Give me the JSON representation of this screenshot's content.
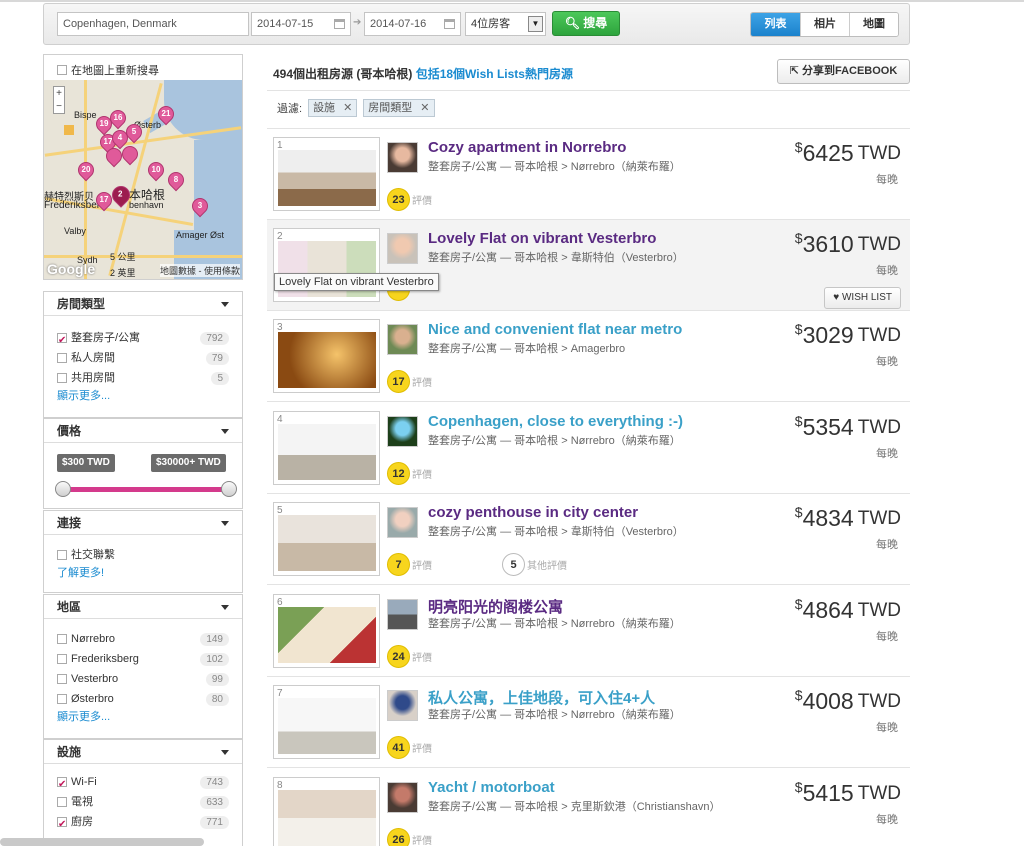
{
  "search": {
    "location": "Copenhagen, Denmark",
    "checkin": "2014-07-15",
    "checkout": "2014-07-16",
    "guests": "4位房客",
    "search_label": "搜尋"
  },
  "views": [
    "列表",
    "相片",
    "地圖"
  ],
  "map": {
    "redo_label": "在地圖上重新搜尋",
    "labels": [
      "Bispe",
      "Østerb",
      "赫特烈斯贝",
      "Frederiksber",
      "本哈根",
      "benhavn",
      "Valby",
      "Amager Øst",
      "Sydh",
      "5 公里",
      "2 英里",
      "地圖數據 - 使用條款",
      "Google"
    ],
    "pins": [
      "19",
      "16",
      "17",
      "4",
      "21",
      "20",
      "10",
      "2",
      "8",
      "17",
      "3",
      "5"
    ]
  },
  "filters_panel": {
    "room_type": {
      "title": "房間類型",
      "options": [
        {
          "label": "整套房子/公寓",
          "count": "792",
          "checked": true
        },
        {
          "label": "私人房間",
          "count": "79",
          "checked": false
        },
        {
          "label": "共用房間",
          "count": "5",
          "checked": false
        }
      ],
      "more": "顯示更多..."
    },
    "price": {
      "title": "價格",
      "min_label": "$300 TWD",
      "max_label": "$30000+ TWD",
      "min_fraction": 0,
      "max_fraction": 1
    },
    "connect": {
      "title": "連接",
      "options": [
        {
          "label": "社交聯繫",
          "checked": false
        }
      ],
      "more": "了解更多!"
    },
    "area": {
      "title": "地區",
      "options": [
        {
          "label": "Nørrebro",
          "count": "149",
          "checked": false
        },
        {
          "label": "Frederiksberg",
          "count": "102",
          "checked": false
        },
        {
          "label": "Vesterbro",
          "count": "99",
          "checked": false
        },
        {
          "label": "Østerbro",
          "count": "80",
          "checked": false
        }
      ],
      "more": "顯示更多..."
    },
    "amenities": {
      "title": "設施",
      "options": [
        {
          "label": "Wi-Fi",
          "count": "743",
          "checked": true
        },
        {
          "label": "電視",
          "count": "633",
          "checked": false
        },
        {
          "label": "廚房",
          "count": "771",
          "checked": true
        }
      ]
    }
  },
  "results": {
    "header": "494個出租房源 (哥本哈根)",
    "wishlist_link": "包括18個Wish Lists熱門房源",
    "share_label": "分享到FACEBOOK",
    "filter_label": "過濾:",
    "chips": [
      "設施",
      "房間類型"
    ],
    "tooltip": "Lovely Flat on vibrant Vesterbro",
    "wish_label": "WISH LIST",
    "per_night": "每晚",
    "review_word": "評價",
    "other_review_word": "其他評價",
    "listings": [
      {
        "num": "1",
        "title": "Cozy apartment in Norrebro",
        "sub": "整套房子/公寓 — 哥本哈根 > Nørrebro（納萊布羅）",
        "reviews": "23",
        "price": "6425",
        "currency": "TWD"
      },
      {
        "num": "2",
        "title": "Lovely Flat on vibrant Vesterbro",
        "sub": "整套房子/公寓 — 哥本哈根 > 韋斯特伯（Vesterbro）",
        "reviews": "",
        "price": "3610",
        "currency": "TWD"
      },
      {
        "num": "3",
        "title": "Nice and convenient flat near metro",
        "sub": "整套房子/公寓 — 哥本哈根 > Amagerbro",
        "reviews": "17",
        "price": "3029",
        "currency": "TWD"
      },
      {
        "num": "4",
        "title": "Copenhagen, close to everything :-)",
        "sub": "整套房子/公寓 — 哥本哈根 > Nørrebro（納萊布羅）",
        "reviews": "12",
        "price": "5354",
        "currency": "TWD"
      },
      {
        "num": "5",
        "title": "cozy penthouse in city center",
        "sub": "整套房子/公寓 — 哥本哈根 > 韋斯特伯（Vesterbro）",
        "reviews": "7",
        "other_reviews": "5",
        "price": "4834",
        "currency": "TWD"
      },
      {
        "num": "6",
        "title": "明亮阳光的阁楼公寓",
        "sub": "整套房子/公寓 — 哥本哈根 > Nørrebro（納萊布羅）",
        "reviews": "24",
        "price": "4864",
        "currency": "TWD"
      },
      {
        "num": "7",
        "title": "私人公寓，上佳地段，可入住4+人",
        "sub": "整套房子/公寓 — 哥本哈根 > Nørrebro（納萊布羅）",
        "reviews": "41",
        "price": "4008",
        "currency": "TWD"
      },
      {
        "num": "8",
        "title": "Yacht / motorboat",
        "sub": "整套房子/公寓 — 哥本哈根 > 克里斯欽港（Christianshavn）",
        "reviews": "26",
        "price": "5415",
        "currency": "TWD"
      }
    ]
  },
  "colors": {
    "accent_blue": "#1a8bd0",
    "title_purple": "#5a2a82",
    "title_teal": "#3aa0c8",
    "search_green": "#2ea43d",
    "pin_pink": "#e05a9a",
    "slider_pink": "#d43a8c",
    "review_yellow": "#f7d51d"
  }
}
